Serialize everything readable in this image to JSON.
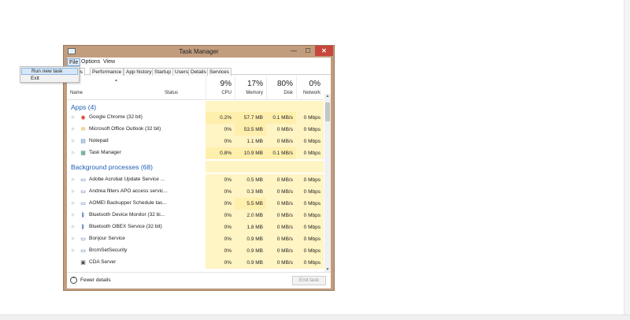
{
  "window": {
    "title": "Task Manager",
    "minimize_glyph": "—",
    "maximize_glyph": "☐",
    "close_glyph": "✕",
    "close_color": "#c7463c",
    "frame_color": "#c19d7e"
  },
  "menu": {
    "file": "File",
    "options": "Options",
    "view": "View"
  },
  "file_menu": {
    "run_new_task": "Run new task",
    "exit": "Exit"
  },
  "tabs": [
    "esses",
    "Performance",
    "App history",
    "Startup",
    "Users",
    "Details",
    "Services"
  ],
  "columns": {
    "name": "Name",
    "status": "Status",
    "cpu_pct": "9%",
    "cpu_label": "CPU",
    "memory_pct": "17%",
    "memory_label": "Memory",
    "disk_pct": "80%",
    "disk_label": "Disk",
    "network_pct": "0%",
    "network_label": "Network"
  },
  "groups": {
    "apps": "Apps (4)",
    "background": "Background processes (68)"
  },
  "apps": [
    {
      "name": "Google Chrome (32 bit)",
      "icon": "chrome-icon",
      "cpu": "0.2%",
      "memory": "57.7 MB",
      "disk": "0.1 MB/s",
      "network": "0 Mbps"
    },
    {
      "name": "Microsoft Office Outlook (32 bit)",
      "icon": "outlook-icon",
      "cpu": "0%",
      "memory": "53.5 MB",
      "disk": "0 MB/s",
      "network": "0 Mbps"
    },
    {
      "name": "Notepad",
      "icon": "notepad-icon",
      "cpu": "0%",
      "memory": "1.1 MB",
      "disk": "0 MB/s",
      "network": "0 Mbps"
    },
    {
      "name": "Task Manager",
      "icon": "task-manager-icon",
      "cpu": "0.8%",
      "memory": "10.9 MB",
      "disk": "0.1 MB/s",
      "network": "0 Mbps"
    }
  ],
  "background": [
    {
      "name": "Adobe Acrobat Update Service ...",
      "icon": "service-window-icon",
      "cpu": "0%",
      "memory": "0.5 MB",
      "disk": "0 MB/s",
      "network": "0 Mbps"
    },
    {
      "name": "Andrea filters APO access servic...",
      "icon": "service-window-icon",
      "cpu": "0%",
      "memory": "0.3 MB",
      "disk": "0 MB/s",
      "network": "0 Mbps"
    },
    {
      "name": "AOMEI Backupper Schedule tas...",
      "icon": "service-window-icon",
      "cpu": "0%",
      "memory": "5.5 MB",
      "disk": "0 MB/s",
      "network": "0 Mbps"
    },
    {
      "name": "Bluetooth Device Monitor (32 bi...",
      "icon": "bluetooth-icon",
      "cpu": "0%",
      "memory": "2.0 MB",
      "disk": "0 MB/s",
      "network": "0 Mbps"
    },
    {
      "name": "Bluetooth OBEX Service (32 bit)",
      "icon": "bluetooth-icon",
      "cpu": "0%",
      "memory": "1.8 MB",
      "disk": "0 MB/s",
      "network": "0 Mbps"
    },
    {
      "name": "Bonjour Service",
      "icon": "service-window-icon",
      "cpu": "0%",
      "memory": "0.9 MB",
      "disk": "0 MB/s",
      "network": "0 Mbps"
    },
    {
      "name": "BrcmSetSecurity",
      "icon": "service-window-icon",
      "cpu": "0%",
      "memory": "0.9 MB",
      "disk": "0 MB/s",
      "network": "0 Mbps"
    },
    {
      "name": "CDA Server",
      "icon": "monitor-icon",
      "cpu": "0%",
      "memory": "0.9 MB",
      "disk": "0 MB/s",
      "network": "0 Mbps"
    }
  ],
  "footer": {
    "fewer_details": "Fewer details",
    "end_task": "End task"
  }
}
